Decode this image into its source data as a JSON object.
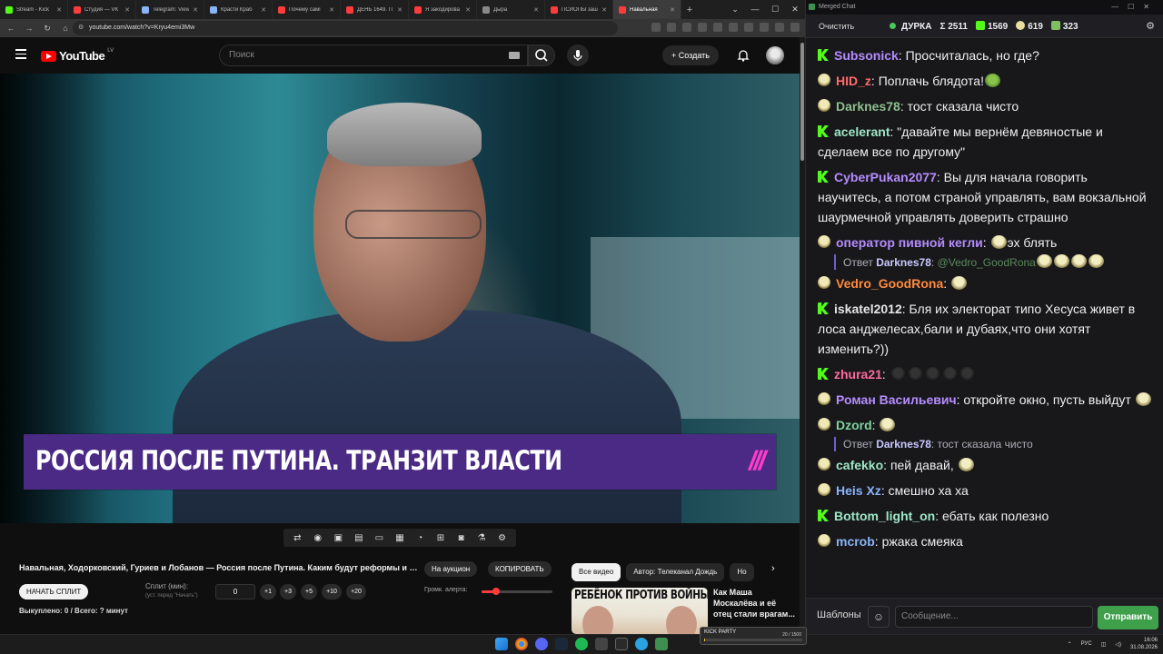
{
  "browser": {
    "tabs": [
      {
        "label": "Stream - Kick",
        "color": "#53fc18"
      },
      {
        "label": "Студия — VK",
        "color": "#ff3b3b"
      },
      {
        "label": "Telegram: View",
        "color": "#8ab4f8"
      },
      {
        "label": "Красти Краб",
        "color": "#8ab4f8"
      },
      {
        "label": "Почему самі",
        "color": "#ff3b3b"
      },
      {
        "label": "ДЕНЬ 1649. П",
        "color": "#ff3b3b"
      },
      {
        "label": "Я закодирова",
        "color": "#ff3b3b"
      },
      {
        "label": "Дыра",
        "color": "#888888"
      },
      {
        "label": "ПСИОПЫ заш",
        "color": "#ff3b3b"
      },
      {
        "label": "Навальная",
        "color": "#ff3b3b"
      }
    ],
    "url": "youtube.com/watch?v=Kryu4emi3Mw"
  },
  "youtube": {
    "logo_text": "YouTube",
    "logo_region": "LV",
    "search_placeholder": "Поиск",
    "create_label": "+ Создать"
  },
  "video": {
    "lower_third_title": "РОССИЯ ПОСЛЕ ПУТИНА. ТРАНЗИТ ВЛАСТИ",
    "lower_third_logo": "///"
  },
  "info": {
    "title": "Навальная, Ходорковский, Гуриев и Лобанов — Россия после Путина. Каким будут реформы и компро...",
    "start_split": "НАЧАТЬ СПЛИТ",
    "split_label": "Сплит (мин):",
    "split_hint": "(уст. перед \"Начать\")",
    "split_value": "0",
    "increments": [
      "+1",
      "+3",
      "+5",
      "+10",
      "+20"
    ],
    "bought": "Выкуплено: 0 / Всего: ? минут",
    "auction": "На аукцион",
    "copy": "КОПИРОВАТЬ",
    "alert_volume_label": "Громк. алерта:",
    "alert_volume": 0.2,
    "chips": [
      "Все видео",
      "Автор: Телеканал Дождь",
      "Но"
    ],
    "related_thumb_title": "РЕБЁНОК ПРОТИВ ВОЙНЫ",
    "related_title": "Как Маша Москалёва и её отец стали врагам..."
  },
  "chat": {
    "window_title": "Merged Chat",
    "clear": "Очистить",
    "channel": "ДУРКА",
    "total": "Σ 2511",
    "kick_count": "1569",
    "emote_count": "619",
    "vk_count": "323",
    "messages": [
      {
        "platform": "kick",
        "user": "Subsonick",
        "color": "#b68cff",
        "text": "Просчиталась, но где?"
      },
      {
        "platform": "emote",
        "user": "HID_z",
        "color": "#ff6b6b",
        "text": "Поплачь блядота!",
        "emotes": [
          "frog"
        ]
      },
      {
        "platform": "emote",
        "user": "Darknes78",
        "color": "#8fbf8f",
        "text": "тост сказала чисто"
      },
      {
        "platform": "kick",
        "user": "acelerant",
        "color": "#9ee6c6",
        "text": "\"давайте мы вернём девяностые и сделаем все по другому\""
      },
      {
        "platform": "kick",
        "user": "CyberPukan2077",
        "color": "#b68cff",
        "text": "Вы для начала говорить научитесь, а потом страной управлять, вам вокзальной шаурмечной управлять доверить страшно"
      },
      {
        "platform": "emote",
        "user": "оператор пивной кегли",
        "color": "#b68cff",
        "text": "эх блять",
        "emotes_before": [
          "pepe"
        ]
      },
      {
        "reply_to": "Darknes78",
        "reply_text": "@Vedro_GoodRona",
        "emotes": [
          "pepe",
          "pepe",
          "pepe",
          "pepe"
        ]
      },
      {
        "platform": "emote",
        "user": "Vedro_GoodRona",
        "color": "#ff8a3d",
        "text": "",
        "emotes": [
          "pepe"
        ]
      },
      {
        "platform": "kick",
        "user": "iskatel2012",
        "color": "#e6e6e6",
        "text": "Бля их электорат типо Хесуса живет в лоса анджелесах,бали и дубаях,что они хотят изменить?))"
      },
      {
        "platform": "kick",
        "user": "zhura21",
        "color": "#ff6b9d",
        "text": "",
        "emotes": [
          "dark",
          "dark",
          "dark",
          "dark",
          "dark"
        ]
      },
      {
        "platform": "emote",
        "user": "Роман Васильевич",
        "color": "#b68cff",
        "text": "откройте окно, пусть выйдут",
        "emotes": [
          "pepe"
        ]
      },
      {
        "platform": "emote",
        "user": "Dzord",
        "color": "#7fd4a0",
        "text": "",
        "emotes": [
          "pepe"
        ]
      },
      {
        "reply_to": "Darknes78",
        "reply_text": "тост сказала чисто"
      },
      {
        "platform": "emote",
        "user": "cafekko",
        "color": "#9ee6c6",
        "text": "пей давай",
        "emotes": [
          "pepe"
        ]
      },
      {
        "platform": "emote",
        "user": "Heis Xz",
        "color": "#8ab4f8",
        "text": "смешно ха ха"
      },
      {
        "platform": "kick",
        "user": "Bottom_light_on",
        "color": "#9ee6c6",
        "text": "ебать как полезно"
      },
      {
        "platform": "emote",
        "user": "mcrob",
        "color": "#8ab4f8",
        "text": "ржака смеяка"
      }
    ],
    "templates": "Шаблоны",
    "input_placeholder": "Сообщение...",
    "send": "Отправить"
  },
  "taskbar": {
    "overlay_label": "KICK PARTY",
    "overlay_count": "20 / 1500",
    "overlay_progress": 0.0133,
    "lang": "РУС",
    "time": "16:06",
    "date": "31.08.2026"
  }
}
